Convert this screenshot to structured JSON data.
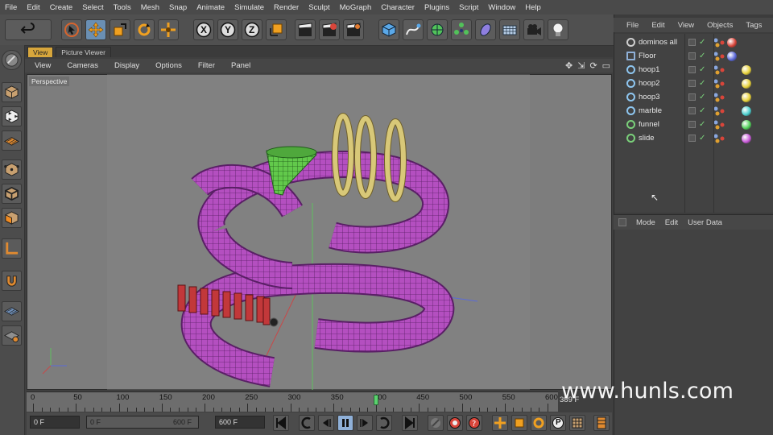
{
  "menubar": [
    "File",
    "Edit",
    "Create",
    "Select",
    "Tools",
    "Mesh",
    "Snap",
    "Animate",
    "Simulate",
    "Render",
    "Sculpt",
    "MoGraph",
    "Character",
    "Plugins",
    "Script",
    "Window",
    "Help"
  ],
  "toolbar": {
    "axis_x": "X",
    "axis_y": "Y",
    "axis_z": "Z"
  },
  "viewport": {
    "tabs": [
      "View",
      "Picture Viewer"
    ],
    "menu": [
      "View",
      "Cameras",
      "Display",
      "Options",
      "Filter",
      "Panel"
    ],
    "label": "Perspective"
  },
  "timeline": {
    "ticks": [
      "0",
      "50",
      "100",
      "150",
      "200",
      "250",
      "300",
      "350",
      "400",
      "450",
      "500",
      "550",
      "600"
    ],
    "current_frame": 400,
    "max_frame": 600,
    "end_label": "389 F"
  },
  "transport": {
    "start_field": "0 F",
    "range_start": "0 F",
    "range_end": "600 F",
    "end_field": "600 F",
    "key_labels": {
      "key_p": "P"
    }
  },
  "object_manager": {
    "menu": [
      "File",
      "Edit",
      "View",
      "Objects",
      "Tags"
    ],
    "objects": [
      {
        "name": "dominos all",
        "icon": "null-object-icon",
        "color": "#cfcfcf",
        "ball": "#d9453a"
      },
      {
        "name": "Floor",
        "icon": "floor-icon",
        "color": "#8fb0d8",
        "ball": "#5b68d8"
      },
      {
        "name": "hoop1",
        "icon": "torus-icon",
        "color": "#8ec6f0",
        "ball": "#e8d23a"
      },
      {
        "name": "hoop2",
        "icon": "torus-icon",
        "color": "#8ec6f0",
        "ball": "#e8d23a"
      },
      {
        "name": "hoop3",
        "icon": "torus-icon",
        "color": "#8ec6f0",
        "ball": "#e8d23a"
      },
      {
        "name": "marble",
        "icon": "sphere-icon",
        "color": "#8ec6f0",
        "ball": "#4bd0d0"
      },
      {
        "name": "funnel",
        "icon": "funnel-icon",
        "color": "#7ad07a",
        "ball": "#52d25a"
      },
      {
        "name": "slide",
        "icon": "sweep-icon",
        "color": "#7ad07a",
        "ball": "#c85ad8"
      }
    ]
  },
  "attribute_manager": {
    "menu": [
      "Mode",
      "Edit",
      "User Data"
    ]
  },
  "watermark": "www.hunls.com",
  "colors": {
    "accent": "#6a8fb3",
    "active_tab": "#d7a63c",
    "playhead": "#5ad26e",
    "tube": "#b44fc0",
    "funnel": "#62c94b",
    "hoops": "#d8c878",
    "dominoes": "#c2383a"
  }
}
